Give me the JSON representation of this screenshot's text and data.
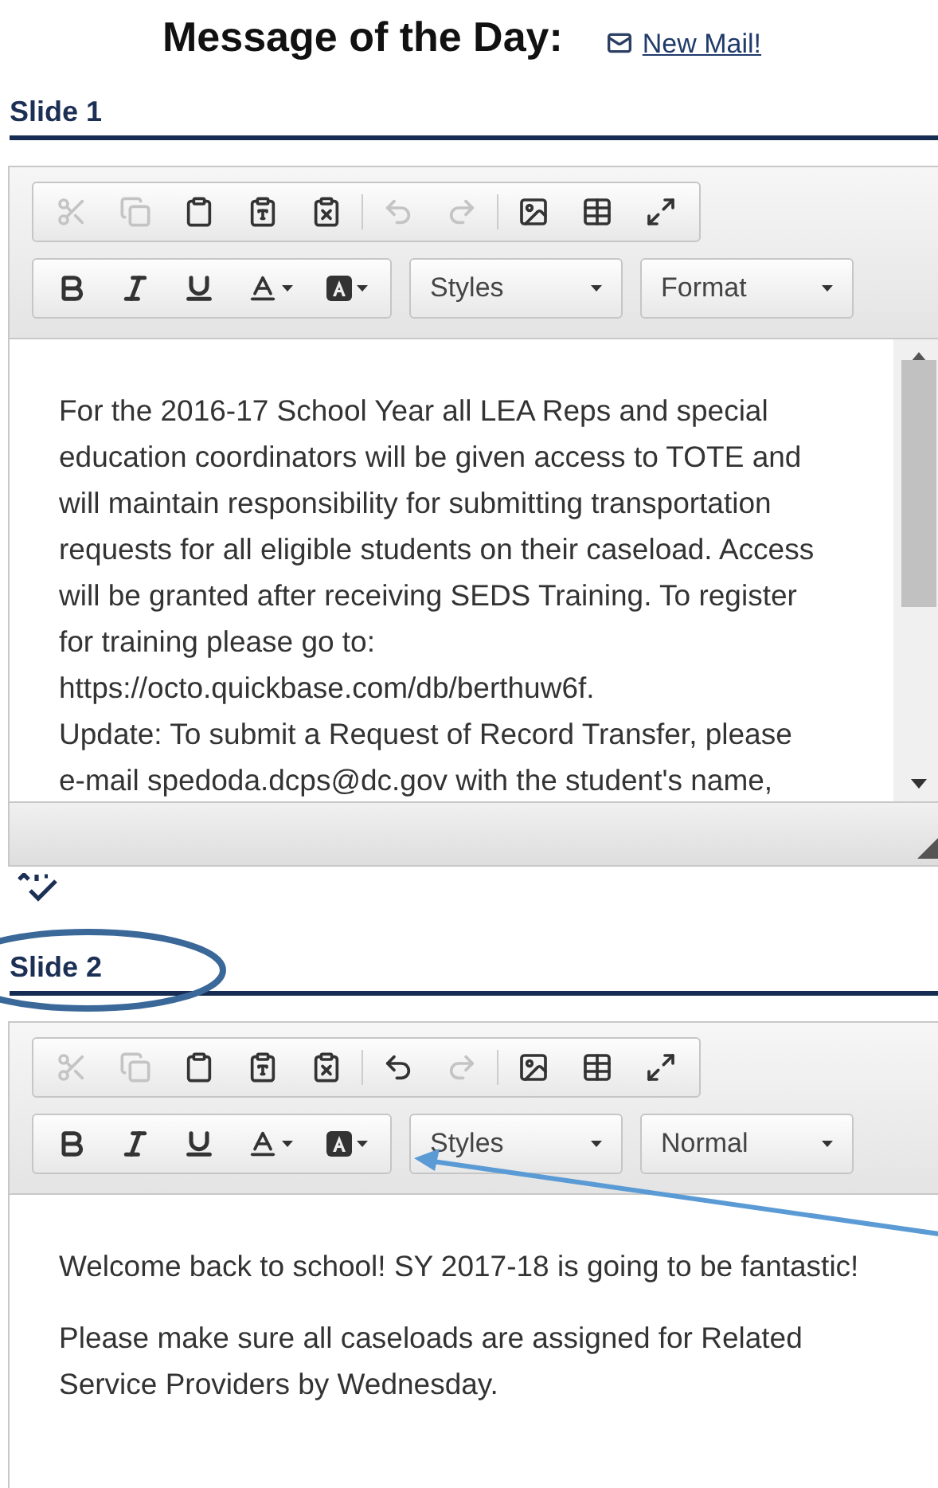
{
  "header": {
    "title": "Message of the Day:",
    "link": "New Mail!"
  },
  "slides": [
    {
      "heading": "Slide 1",
      "clipboard": [
        {
          "kind": "cut",
          "disabled": true
        },
        {
          "kind": "copy",
          "disabled": true
        },
        {
          "kind": "paste",
          "disabled": false
        },
        {
          "kind": "paste-text",
          "disabled": false
        },
        {
          "kind": "paste-word",
          "disabled": false
        }
      ],
      "history": [
        {
          "kind": "undo",
          "disabled": true
        },
        {
          "kind": "redo",
          "disabled": true
        }
      ],
      "insert": [
        {
          "kind": "image",
          "disabled": false
        },
        {
          "kind": "table",
          "disabled": false
        },
        {
          "kind": "maximize",
          "disabled": false
        }
      ],
      "basic": [
        {
          "kind": "bold",
          "disabled": false
        },
        {
          "kind": "italic",
          "disabled": false
        },
        {
          "kind": "underline",
          "disabled": false
        },
        {
          "kind": "text-color",
          "disabled": false
        },
        {
          "kind": "bg-color",
          "disabled": false
        }
      ],
      "styles": "Styles",
      "format": "Format",
      "scrollbar": true,
      "paragraphs": [
        {
          "lines": [
            "For the 2016-17 School Year all LEA Reps and special",
            "education coordinators will be given access to TOTE and",
            "will maintain responsibility for submitting transportation",
            "requests for all eligible students on their caseload. Access",
            "will be granted after receiving SEDS Training. To register",
            "for training please go to:",
            "https://octo.quickbase.com/db/berthuw6f.",
            "Update: To submit a Request of Record Transfer, please",
            "e-mail spedoda.dcps@dc.gov with the student's name,"
          ]
        }
      ]
    },
    {
      "heading": "Slide 2",
      "clipboard": [
        {
          "kind": "cut",
          "disabled": true
        },
        {
          "kind": "copy",
          "disabled": true
        },
        {
          "kind": "paste",
          "disabled": false
        },
        {
          "kind": "paste-text",
          "disabled": false
        },
        {
          "kind": "paste-word",
          "disabled": false
        }
      ],
      "history": [
        {
          "kind": "undo",
          "disabled": false
        },
        {
          "kind": "redo",
          "disabled": true
        }
      ],
      "insert": [
        {
          "kind": "image",
          "disabled": false
        },
        {
          "kind": "table",
          "disabled": false
        },
        {
          "kind": "maximize",
          "disabled": false
        }
      ],
      "basic": [
        {
          "kind": "bold",
          "disabled": false
        },
        {
          "kind": "italic",
          "disabled": false
        },
        {
          "kind": "underline",
          "disabled": false
        },
        {
          "kind": "text-color",
          "disabled": false
        },
        {
          "kind": "bg-color",
          "disabled": false
        }
      ],
      "styles": "Styles",
      "format": "Normal",
      "scrollbar": false,
      "paragraphs": [
        {
          "lines": [
            "Welcome back to school! SY 2017-18 is going to be fantastic!"
          ]
        },
        {
          "lines": [
            "Please make sure all caseloads are assigned for Related",
            "Service Providers by Wednesday."
          ]
        }
      ]
    }
  ]
}
